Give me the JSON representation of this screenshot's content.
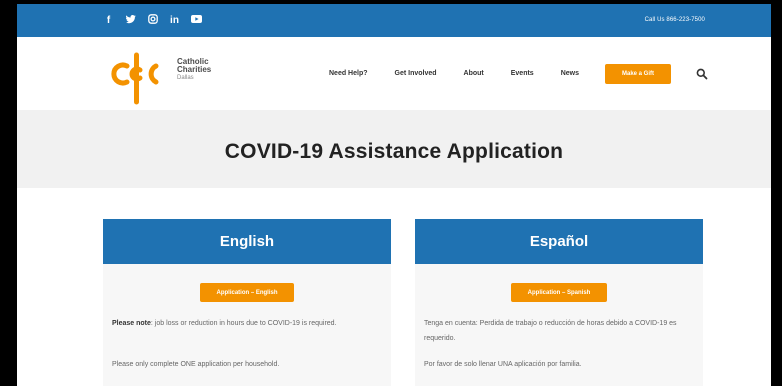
{
  "topbar": {
    "social_icons": [
      "facebook-icon",
      "twitter-icon",
      "instagram-icon",
      "linkedin-icon",
      "youtube-icon"
    ],
    "social_glyphs": [
      "f",
      "🐦",
      "◎",
      "in",
      "▶"
    ],
    "call_us": "Call Us 866-223-7500"
  },
  "logo": {
    "line1": "Catholic",
    "line2": "Charities",
    "line3": "Dallas"
  },
  "nav": {
    "items": [
      "Need Help?",
      "Get Involved",
      "About",
      "Events",
      "News"
    ],
    "gift_button": "Make a Gift"
  },
  "hero": {
    "title": "COVID-19 Assistance Application"
  },
  "english": {
    "header": "English",
    "button": "Application – English",
    "note_lead": "Please note",
    "note_rest": ": job loss or reduction in hours due to COVID-19 is required.",
    "note2": "Please only complete ONE application per household."
  },
  "spanish": {
    "header": "Español",
    "button": "Application – Spanish",
    "note1": "Tenga en cuenta: Perdida de trabajo o reducción de horas debido a COVID-19 es requerido.",
    "note2": "Por favor de solo llenar UNA aplicación por familia."
  },
  "colors": {
    "brand_blue": "#1f72b2",
    "accent_orange": "#f39200",
    "hero_gray": "#f1f1f1"
  }
}
